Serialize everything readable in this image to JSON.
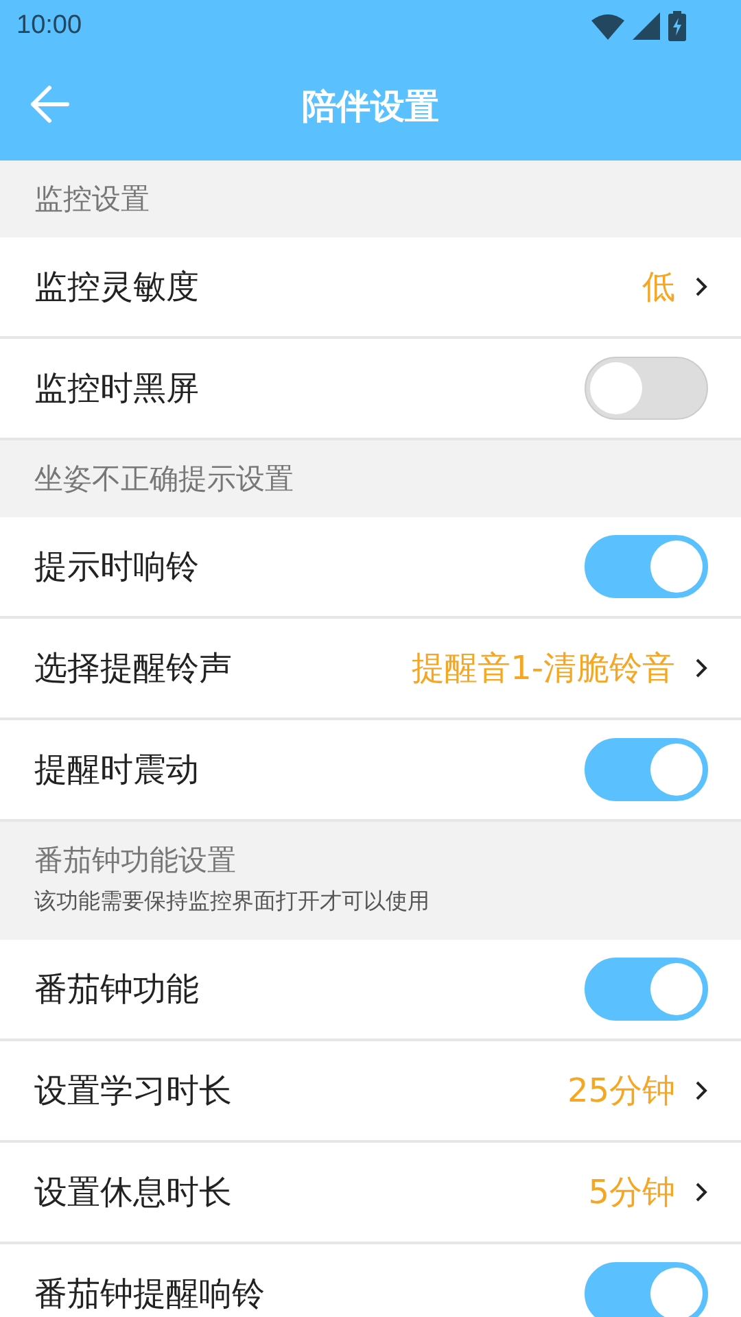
{
  "status_bar": {
    "time": "10:00"
  },
  "app_bar": {
    "title": "陪伴设置"
  },
  "sections": [
    {
      "title": "监控设置",
      "rows": [
        {
          "kind": "value",
          "label": "监控灵敏度",
          "value": "低"
        },
        {
          "kind": "toggle",
          "label": "监控时黑屏",
          "on": false
        }
      ]
    },
    {
      "title": "坐姿不正确提示设置",
      "rows": [
        {
          "kind": "toggle",
          "label": "提示时响铃",
          "on": true
        },
        {
          "kind": "value",
          "label": "选择提醒铃声",
          "value": "提醒音1-清脆铃音"
        },
        {
          "kind": "toggle",
          "label": "提醒时震动",
          "on": true
        }
      ]
    },
    {
      "title": "番茄钟功能设置",
      "note": "该功能需要保持监控界面打开才可以使用",
      "rows": [
        {
          "kind": "toggle",
          "label": "番茄钟功能",
          "on": true
        },
        {
          "kind": "value",
          "label": "设置学习时长",
          "value": "25分钟"
        },
        {
          "kind": "value",
          "label": "设置休息时长",
          "value": "5分钟"
        },
        {
          "kind": "toggle",
          "label": "番茄钟提醒响铃",
          "on": true
        }
      ]
    }
  ]
}
